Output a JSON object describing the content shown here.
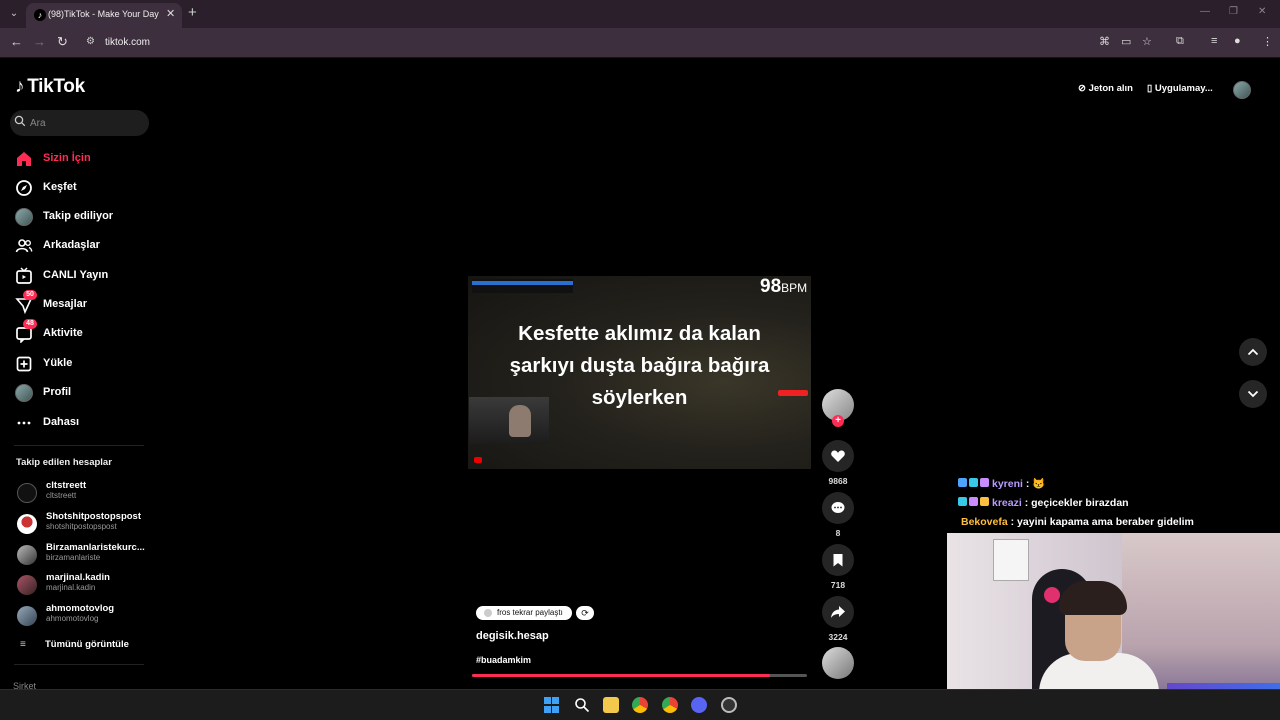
{
  "browser": {
    "tab_title": "(98)TikTok - Make Your Day",
    "url": "tiktok.com",
    "new_tab": "+",
    "tab_close": "✕"
  },
  "brand": {
    "name": "TikTok"
  },
  "search": {
    "placeholder": "Ara"
  },
  "nav": {
    "items": [
      {
        "label": "Sizin İçin",
        "icon": "home-icon",
        "active": true
      },
      {
        "label": "Keşfet",
        "icon": "compass-icon"
      },
      {
        "label": "Takip ediliyor",
        "icon": "following-avatar"
      },
      {
        "label": "Arkadaşlar",
        "icon": "friends-icon"
      },
      {
        "label": "CANLI Yayın",
        "icon": "live-icon"
      },
      {
        "label": "Mesajlar",
        "icon": "messages-icon",
        "badge": "50"
      },
      {
        "label": "Aktivite",
        "icon": "activity-icon",
        "badge": "48"
      },
      {
        "label": "Yükle",
        "icon": "upload-icon"
      },
      {
        "label": "Profil",
        "icon": "profile-avatar"
      },
      {
        "label": "Dahası",
        "icon": "more-icon"
      }
    ]
  },
  "following": {
    "title": "Takip edilen hesaplar",
    "accounts": [
      {
        "name": "cltstreett",
        "handle": "cltstreett"
      },
      {
        "name": "Shotshitpostopspost",
        "handle": "shotshitpostopspost"
      },
      {
        "name": "Birzamanlaristekurc...",
        "handle": "birzamanlariste"
      },
      {
        "name": "marjinal.kadin",
        "handle": "marjinal.kadin"
      },
      {
        "name": "ahmomotovlog",
        "handle": "ahmomotovlog"
      }
    ],
    "see_all": "Tümünü görüntüle"
  },
  "footer": {
    "company": "Şirket"
  },
  "header": {
    "coins": "Jeton alın",
    "app": "Uygulamay..."
  },
  "video": {
    "bpm_value": "98",
    "bpm_unit": "BPM",
    "caption_lines": [
      "Kesfette aklımız da kalan",
      "şarkıyı duşta bağıra bağıra",
      "söylerken"
    ],
    "progress": 0.89
  },
  "actions": {
    "likes": "9868",
    "comments": "8",
    "saves": "718",
    "shares": "3224"
  },
  "post": {
    "repost_label": "fros tekrar paylaştı",
    "author": "degisik.hesap",
    "hashtag": "#buadamkim"
  },
  "chat": [
    {
      "user": "kyreni",
      "message": "😾",
      "user_color": "#b89cff"
    },
    {
      "user": "kreazi",
      "message": "geçicekler birazdan",
      "user_color": "#b89cff"
    },
    {
      "user": "Bekovefa",
      "message": "yayini kapama ama beraber gidelim",
      "user_color": "#ffbf3f"
    }
  ],
  "colors": {
    "accent": "#fe2c55",
    "background": "#000000"
  }
}
